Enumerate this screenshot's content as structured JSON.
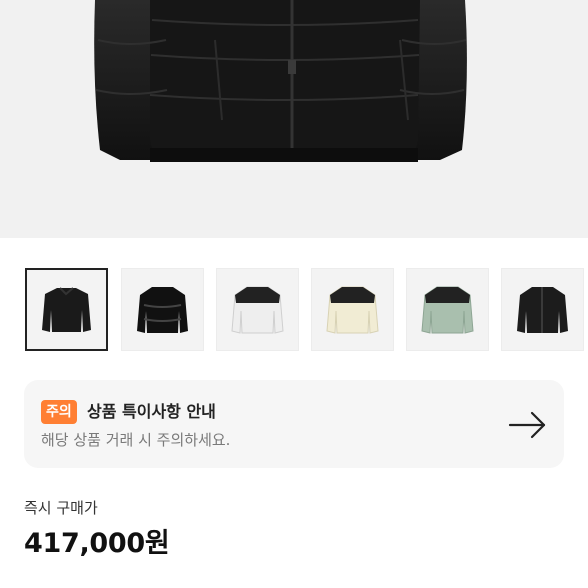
{
  "notice": {
    "badge": "주의",
    "title": "상품 특이사항 안내",
    "subtitle": "해당 상품 거래 시 주의하세요.",
    "arrow_icon": "arrow-right-icon"
  },
  "price": {
    "label": "즉시 구매가",
    "value": "417,000원"
  },
  "thumbnails": [
    {
      "color": "#1a1a1a",
      "selected": true
    },
    {
      "color": "#111111",
      "selected": false
    },
    {
      "color": "#eeeeee",
      "selected": false
    },
    {
      "color": "#f1ecd4",
      "selected": false
    },
    {
      "color": "#a9bfae",
      "selected": false
    },
    {
      "color": "#1c1c1c",
      "selected": false
    }
  ],
  "colors": {
    "accent": "#ff7f33",
    "card_bg": "#f6f6f6"
  }
}
